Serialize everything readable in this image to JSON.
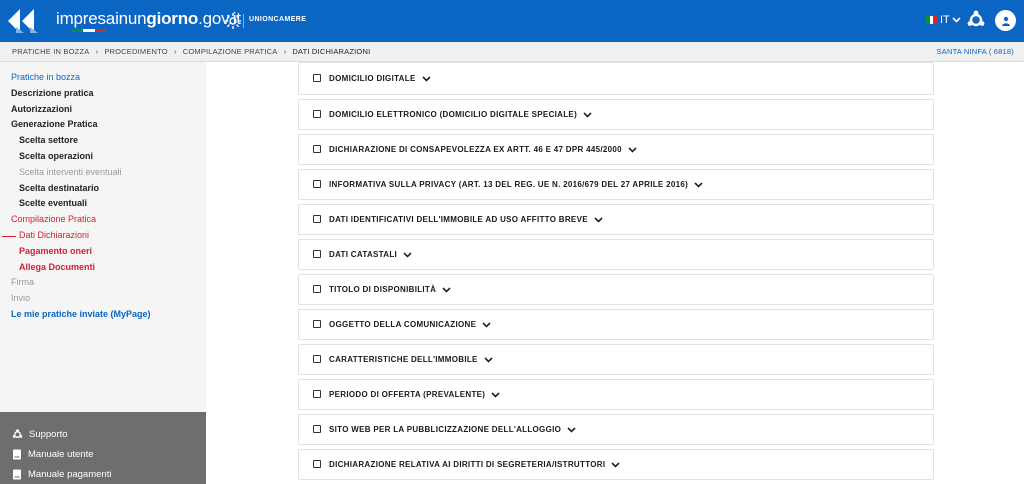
{
  "header": {
    "brand_part1": "impresainun",
    "brand_part2": "giorno",
    "brand_part3": ".gov.it",
    "partner": "UNIONCAMERE",
    "language": "IT",
    "colors": {
      "primary": "#0a66c2",
      "flag_green": "#009246",
      "flag_white": "#ffffff",
      "flag_red": "#ce2b37"
    }
  },
  "breadcrumb": [
    "PRATICHE IN BOZZA",
    "PROCEDIMENTO",
    "COMPILAZIONE PRATICA",
    "DATI DICHIARAZIONI"
  ],
  "user_code": "SANTA NINFA ( 6818)",
  "sidebar": {
    "items": [
      {
        "label": "Pratiche in bozza",
        "style": "blue",
        "sub": false
      },
      {
        "label": "Descrizione pratica",
        "style": "dark",
        "sub": false
      },
      {
        "label": "Autorizzazioni",
        "style": "dark",
        "sub": false
      },
      {
        "label": "Generazione Pratica",
        "style": "dark",
        "sub": false
      },
      {
        "label": "Scelta settore",
        "style": "dark",
        "sub": true
      },
      {
        "label": "Scelta operazioni",
        "style": "dark",
        "sub": true
      },
      {
        "label": "Scelta interventi eventuali",
        "style": "gray",
        "sub": true
      },
      {
        "label": "Scelta destinatario",
        "style": "dark",
        "sub": true
      },
      {
        "label": "Scelte eventuali",
        "style": "dark",
        "sub": true
      },
      {
        "label": "Compilazione Pratica",
        "style": "red",
        "sub": false
      },
      {
        "label": "Dati Dichiarazioni",
        "style": "red",
        "sub": true,
        "current": true
      },
      {
        "label": "Pagamento oneri",
        "style": "red-bold",
        "sub": true
      },
      {
        "label": "Allega Documenti",
        "style": "red-bold",
        "sub": true
      },
      {
        "label": "Firma",
        "style": "gray",
        "sub": false
      },
      {
        "label": "Invio",
        "style": "gray",
        "sub": false
      },
      {
        "label": "Le mie pratiche inviate (MyPage)",
        "style": "blue-bold",
        "sub": false
      }
    ],
    "support": {
      "support_label": "Supporto",
      "user_manual_label": "Manuale utente",
      "payments_manual_label": "Manuale pagamenti"
    }
  },
  "sections": [
    "DOMICILIO DIGITALE",
    "DOMICILIO ELETTRONICO (DOMICILIO DIGITALE SPECIALE)",
    "DICHIARAZIONE DI CONSAPEVOLEZZA EX ARTT. 46 E 47 DPR 445/2000",
    "INFORMATIVA SULLA PRIVACY (ART. 13 DEL REG. UE N. 2016/679 DEL 27 APRILE 2016)",
    "DATI IDENTIFICATIVI DELL'IMMOBILE AD USO AFFITTO BREVE",
    "DATI CATASTALI",
    "TITOLO DI DISPONIBILITÀ",
    "OGGETTO DELLA COMUNICAZIONE",
    "CARATTERISTICHE DELL'IMMOBILE",
    "PERIODO DI OFFERTA (PREVALENTE)",
    "SITO WEB PER LA PUBBLICIZZAZIONE DELL'ALLOGGIO",
    "DICHIARAZIONE RELATIVA AI DIRITTI DI SEGRETERIA/ISTRUTTORI"
  ]
}
